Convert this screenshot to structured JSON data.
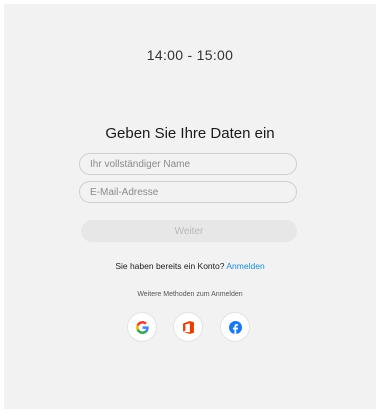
{
  "meeting": {
    "time_range": "14:00 - 15:00"
  },
  "form": {
    "title": "Geben Sie Ihre Daten ein",
    "name_placeholder": "Ihr vollständiger Name",
    "email_placeholder": "E-Mail-Adresse",
    "continue_label": "Weiter"
  },
  "signin": {
    "prompt": "Sie haben bereits ein Konto?",
    "link_label": "Anmelden"
  },
  "other_methods": {
    "label": "Weitere Methoden zum Anmelden",
    "providers": [
      {
        "name": "google-icon"
      },
      {
        "name": "office-icon"
      },
      {
        "name": "facebook-icon"
      }
    ]
  },
  "colors": {
    "link": "#1b8ad8",
    "background": "#f2f2f2",
    "google_blue": "#4285f4",
    "google_red": "#ea4335",
    "google_yellow": "#fbbc05",
    "google_green": "#34a853",
    "office_orange": "#eb3c00",
    "facebook_blue": "#1877f2"
  }
}
